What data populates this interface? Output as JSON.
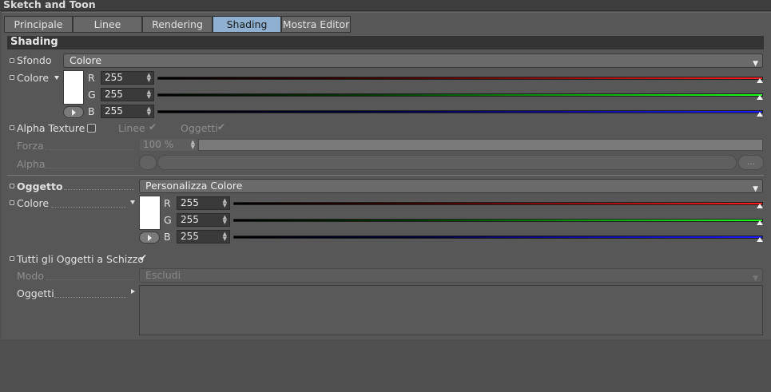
{
  "window": {
    "title": "Sketch and Toon"
  },
  "tabs": [
    {
      "label": "Principale",
      "active": false
    },
    {
      "label": "Linee",
      "active": false
    },
    {
      "label": "Rendering",
      "active": false
    },
    {
      "label": "Shading",
      "active": true
    },
    {
      "label": "Mostra Editor",
      "active": false
    }
  ],
  "section": {
    "title": "Shading"
  },
  "sfondo": {
    "label": "Sfondo",
    "value": "Colore",
    "colore_label": "Colore",
    "color_hex": "#FFFFFF",
    "r_label": "R",
    "r_value": "255",
    "g_label": "G",
    "g_value": "255",
    "b_label": "B",
    "b_value": "255"
  },
  "alpha_texture": {
    "label": "Alpha Texture",
    "checked": false,
    "linee_label": "Linee",
    "oggetti_label": "Oggetti",
    "forza_label": "Forza",
    "forza_value": "100 %",
    "alpha_label": "Alpha",
    "browse_label": "..."
  },
  "oggetto": {
    "label": "Oggetto",
    "value": "Personalizza Colore",
    "colore_label": "Colore",
    "color_hex": "#FFFFFF",
    "r_label": "R",
    "r_value": "255",
    "g_label": "G",
    "g_value": "255",
    "b_label": "B",
    "b_value": "255"
  },
  "tutti": {
    "label": "Tutti gli Oggetti a Schizzo",
    "checked": true,
    "modo_label": "Modo",
    "modo_value": "Escludi",
    "oggetti_label": "Oggetti"
  },
  "colors": {
    "red": "#ff1a1a",
    "green": "#1aff1a",
    "blue": "#1a1aff",
    "active_tab": "#8fb0d0"
  },
  "icons": [
    "chevron-down-icon",
    "play-icon",
    "check-icon",
    "spin-arrows-icon",
    "triangle-right-icon"
  ]
}
